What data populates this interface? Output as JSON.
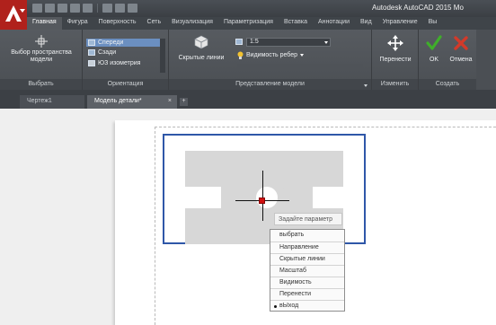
{
  "title_bar": {
    "app_title": "Autodesk AutoCAD 2015   Мо"
  },
  "ribbon_tabs": [
    {
      "label": "Главная"
    },
    {
      "label": "Фигура"
    },
    {
      "label": "Поверхность"
    },
    {
      "label": "Сеть"
    },
    {
      "label": "Визуализация"
    },
    {
      "label": "Параметризация"
    },
    {
      "label": "Вставка"
    },
    {
      "label": "Аннотации"
    },
    {
      "label": "Вид"
    },
    {
      "label": "Управление"
    },
    {
      "label": "Вы"
    }
  ],
  "ribbon": {
    "select_panel": {
      "title": "Выбрать",
      "space_button_line1": "Выбор пространства",
      "space_button_line2": "модели"
    },
    "orientation_panel": {
      "title": "Ориентация",
      "items": [
        {
          "label": "Спереди"
        },
        {
          "label": "Сзади"
        },
        {
          "label": "ЮЗ изометрия"
        }
      ]
    },
    "model_view_panel": {
      "title": "Представление модели",
      "hidden_lines_label": "Скрытые линии",
      "scale_value": "1:5",
      "edge_visibility_label": "Видимость ребер"
    },
    "modify_panel": {
      "title": "Изменить",
      "move_label": "Перенести"
    },
    "create_panel": {
      "title": "Создать",
      "ok_label": "OK",
      "cancel_label": "Отмена"
    }
  },
  "doc_tabs": [
    {
      "label": "Чертеж1"
    },
    {
      "label": "Модель детали*"
    }
  ],
  "prompt": {
    "text": "Задайте параметр"
  },
  "context_menu": {
    "items": [
      {
        "label": "выбрать"
      },
      {
        "label": "Направление"
      },
      {
        "label": "Скрытые линии"
      },
      {
        "label": "Масштаб"
      },
      {
        "label": "Видимость"
      },
      {
        "label": "Перенести"
      },
      {
        "label": "вЫход"
      }
    ]
  },
  "colors": {
    "app_red": "#b0211c",
    "ok_green": "#3fae2a",
    "cancel_red": "#d23a2a",
    "frame_blue": "#2f57a8",
    "grip_red": "#d01010"
  }
}
